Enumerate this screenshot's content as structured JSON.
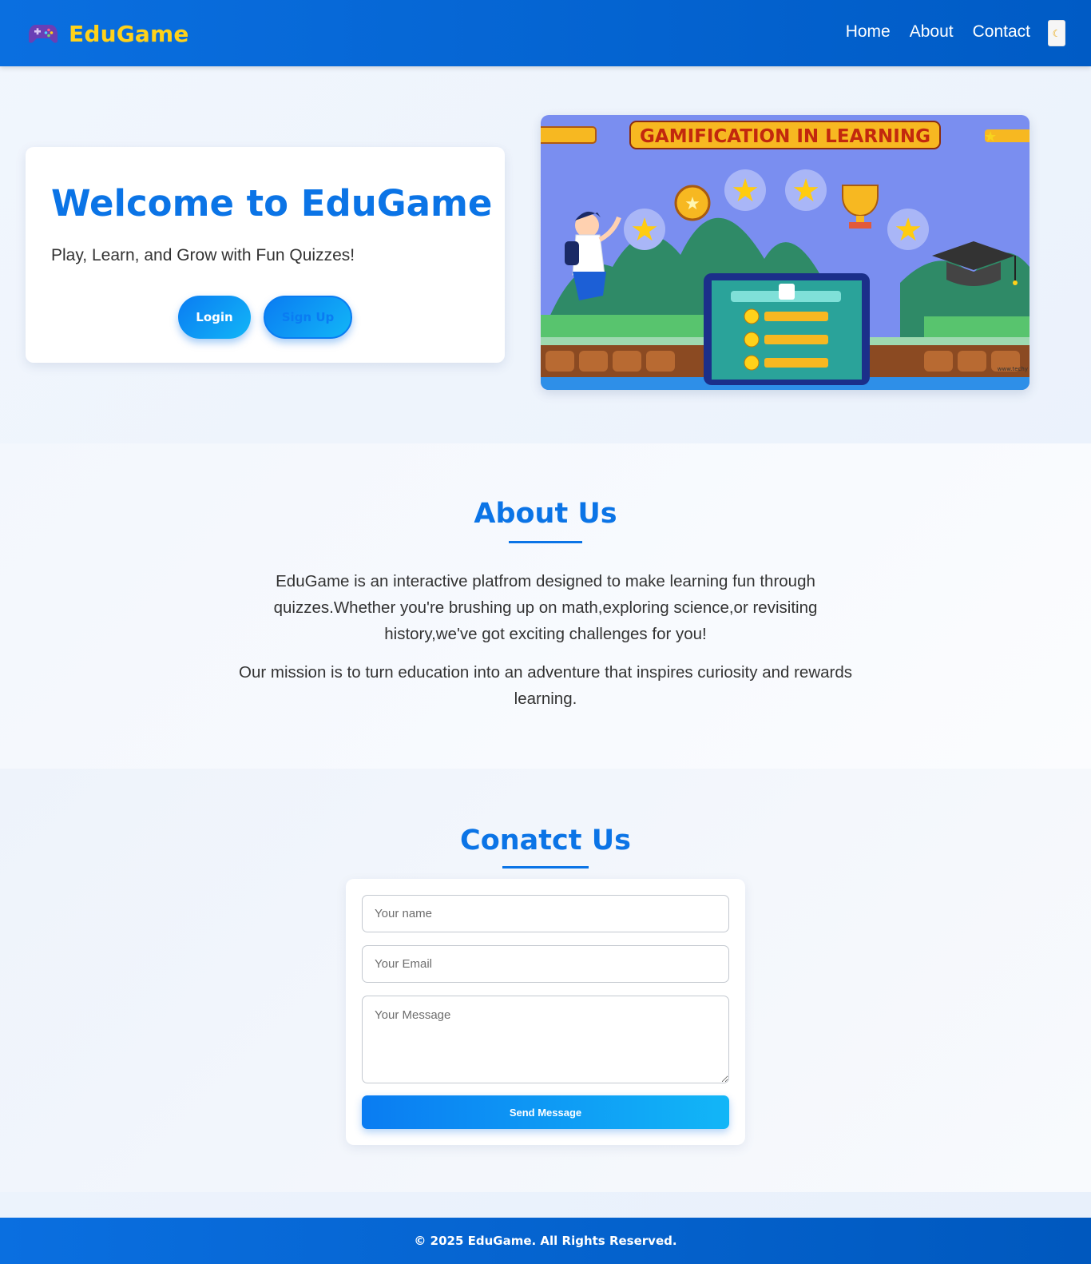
{
  "navbar": {
    "logo_icon": "gamepad-icon",
    "logo_text": "EduGame",
    "links": [
      "Home",
      "About",
      "Contact"
    ],
    "theme_toggle_icon": "moon-icon"
  },
  "hero": {
    "title": "Welcome to EduGame",
    "subtitle": "Play, Learn, and Grow with Fun Quizzes!",
    "login_label": "Login",
    "signup_label": "Sign Up",
    "image_caption": "GAMIFICATION IN LEARNING"
  },
  "about": {
    "title": "About Us",
    "paragraph1": "EduGame is an interactive platfrom designed to make learning fun through quizzes.Whether you're brushing up on math,exploring science,or revisiting history,we've got exciting challenges for you!",
    "paragraph2": "Our mission is to turn education into an adventure that inspires curiosity and rewards learning."
  },
  "contact": {
    "title": "Conatct Us",
    "name_placeholder": "Your name",
    "email_placeholder": "Your Email",
    "message_placeholder": "Your Message",
    "send_label": "Send Message"
  },
  "footer": {
    "text": "© 2025 EduGame. All Rights Reserved."
  },
  "colors": {
    "primary": "#0b74e6",
    "navbar": "#0a6fe0",
    "logo_text": "#ffd21a",
    "button_gradient_end": "#12b6f7"
  }
}
